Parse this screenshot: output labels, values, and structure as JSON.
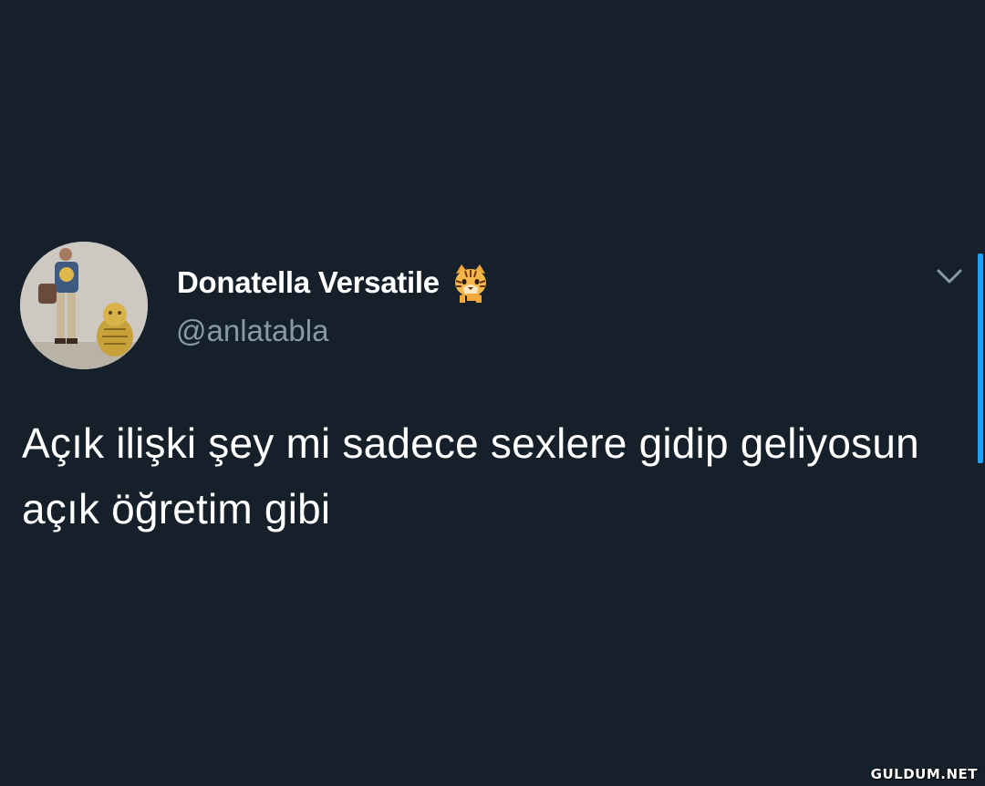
{
  "tweet": {
    "display_name": "Donatella Versatile",
    "name_emoji": "tiger-face-emoji",
    "handle": "@anlatabla",
    "text": "Açık ilişki şey mi sadece sexlere gidip geliyosun açık öğretim gibi",
    "more_icon": "chevron-down-icon"
  },
  "watermark": "GULDUM.NET",
  "colors": {
    "background": "#15202b",
    "text": "#ffffff",
    "secondary_text": "#8899a6",
    "accent": "#1da1f2"
  }
}
